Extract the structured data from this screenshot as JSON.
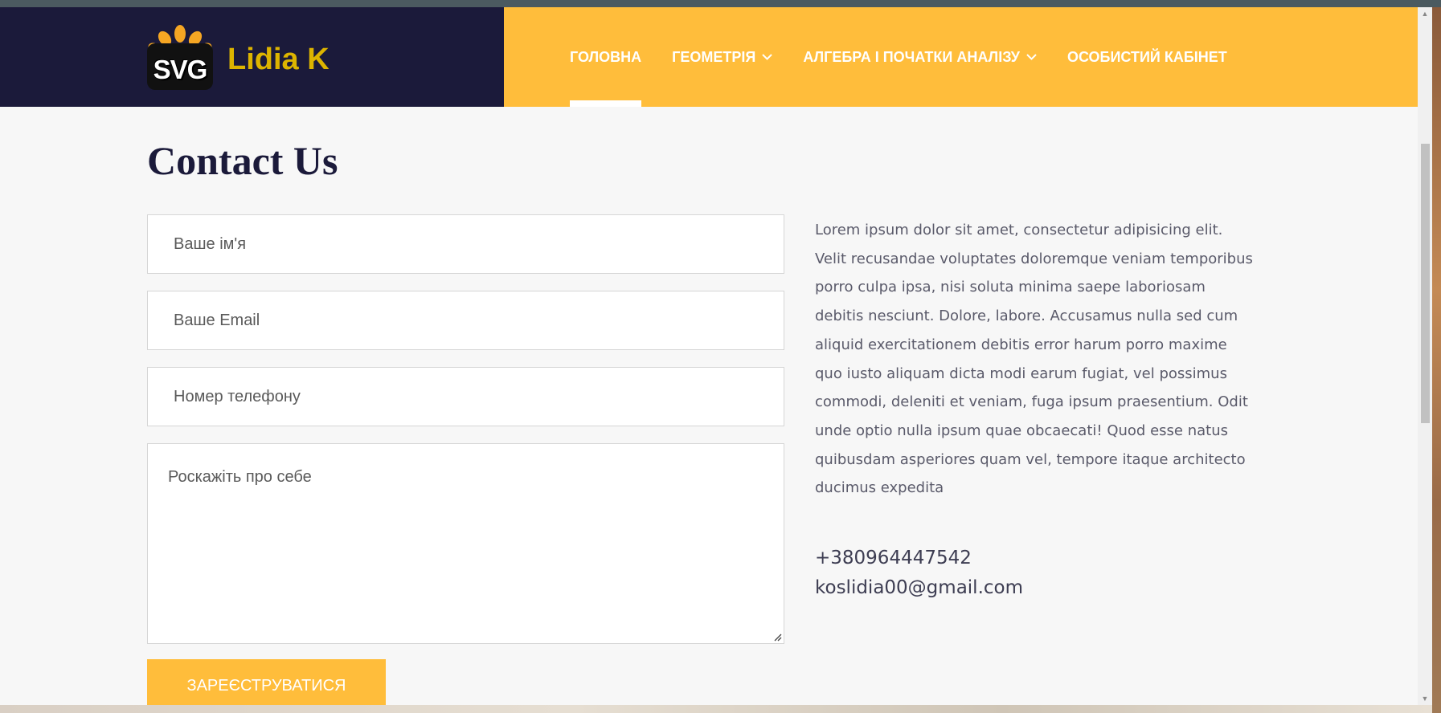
{
  "brand": {
    "logo_text": "SVG",
    "name": "Lidia K"
  },
  "nav": {
    "items": [
      {
        "label": "ГОЛОВНА",
        "active": true,
        "dropdown": false
      },
      {
        "label": "ГЕОМЕТРІЯ",
        "active": false,
        "dropdown": true
      },
      {
        "label": "АЛГЕБРА І ПОЧАТКИ АНАЛІЗУ",
        "active": false,
        "dropdown": true
      },
      {
        "label": "ОСОБИСТИЙ КАБІНЕТ",
        "active": false,
        "dropdown": false
      }
    ]
  },
  "page": {
    "title": "Contact Us"
  },
  "form": {
    "name_placeholder": "Ваше ім'я",
    "email_placeholder": "Ваше Email",
    "phone_placeholder": "Номер телефону",
    "message_placeholder": "Роскажіть про себе",
    "submit_label": "ЗАРЕЄСТРУВАТИСЯ"
  },
  "about": {
    "text": "Lorem ipsum dolor sit amet, consectetur adipisicing elit. Velit recusandae voluptates doloremque veniam temporibus porro culpa ipsa, nisi soluta minima saepe laboriosam debitis nesciunt. Dolore, labore. Accusamus nulla sed cum aliquid exercitationem debitis error harum porro maxime quo iusto aliquam dicta modi earum fugiat, vel possimus commodi, deleniti et veniam, fuga ipsum praesentium. Odit unde optio nulla ipsum quae obcaecati! Quod esse natus quibusdam asperiores quam vel, tempore itaque architecto ducimus expedita"
  },
  "contact": {
    "phone": "+380964447542",
    "email": "koslidia00@gmail.com"
  },
  "colors": {
    "brand_dark": "#1b1a3a",
    "accent": "#ffbd3b",
    "logo_gold": "#ddb400"
  },
  "icons": {
    "dropdown": "chevron-down-icon"
  }
}
